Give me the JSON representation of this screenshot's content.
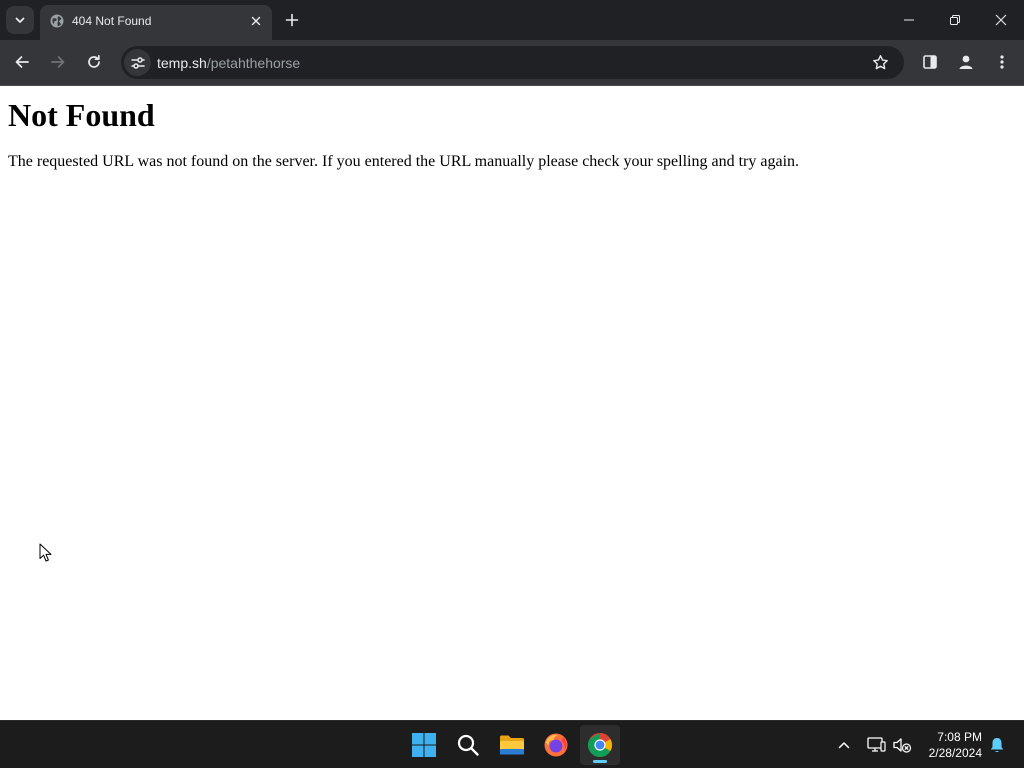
{
  "browser": {
    "tab": {
      "title": "404 Not Found"
    },
    "address": {
      "host": "temp.sh",
      "path": "/petahthehorse"
    }
  },
  "page": {
    "heading": "Not Found",
    "message": "The requested URL was not found on the server. If you entered the URL manually please check your spelling and try again."
  },
  "taskbar": {
    "apps": [
      {
        "name": "start",
        "icon": "windows-logo-icon"
      },
      {
        "name": "search",
        "icon": "search-icon"
      },
      {
        "name": "file-explorer",
        "icon": "folder-icon"
      },
      {
        "name": "firefox",
        "icon": "firefox-icon"
      },
      {
        "name": "chrome",
        "icon": "chrome-icon",
        "active": true
      }
    ],
    "clock": {
      "time": "7:08 PM",
      "date": "2/28/2024"
    }
  },
  "colors": {
    "titlebar": "#202124",
    "toolbar": "#35363a",
    "taskbar": "#1c1c1c",
    "accent": "#60cdff"
  }
}
